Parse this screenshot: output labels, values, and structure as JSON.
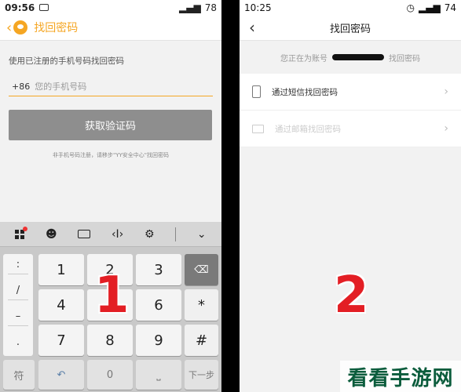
{
  "left": {
    "status": {
      "time": "09:56",
      "battery": "78"
    },
    "title": "找回密码",
    "hint": "使用已注册的手机号码找回密码",
    "phone_prefix": "+86",
    "phone_placeholder": "您的手机号码",
    "get_code_button": "获取验证码",
    "note": "非手机号码注册，请移步\"YY安全中心\"找回密码",
    "step_label": "1"
  },
  "keyboard": {
    "symbols": [
      ":",
      "/",
      "–",
      "."
    ],
    "keys": [
      "1",
      "2",
      "3",
      "4",
      "5",
      "6",
      "7",
      "8",
      "9"
    ],
    "asterisk": "*",
    "hash": "#",
    "bottom": {
      "sym": "符",
      "zero": "0",
      "next": "下一步"
    }
  },
  "right": {
    "status": {
      "time": "10:25",
      "battery": "74"
    },
    "title": "找回密码",
    "account_prefix": "您正在为账号",
    "account_suffix": "找回密码",
    "option_sms": "通过短信找回密码",
    "option_email": "通过邮箱找回密码",
    "step_label": "2"
  },
  "watermark": "看看手游网"
}
